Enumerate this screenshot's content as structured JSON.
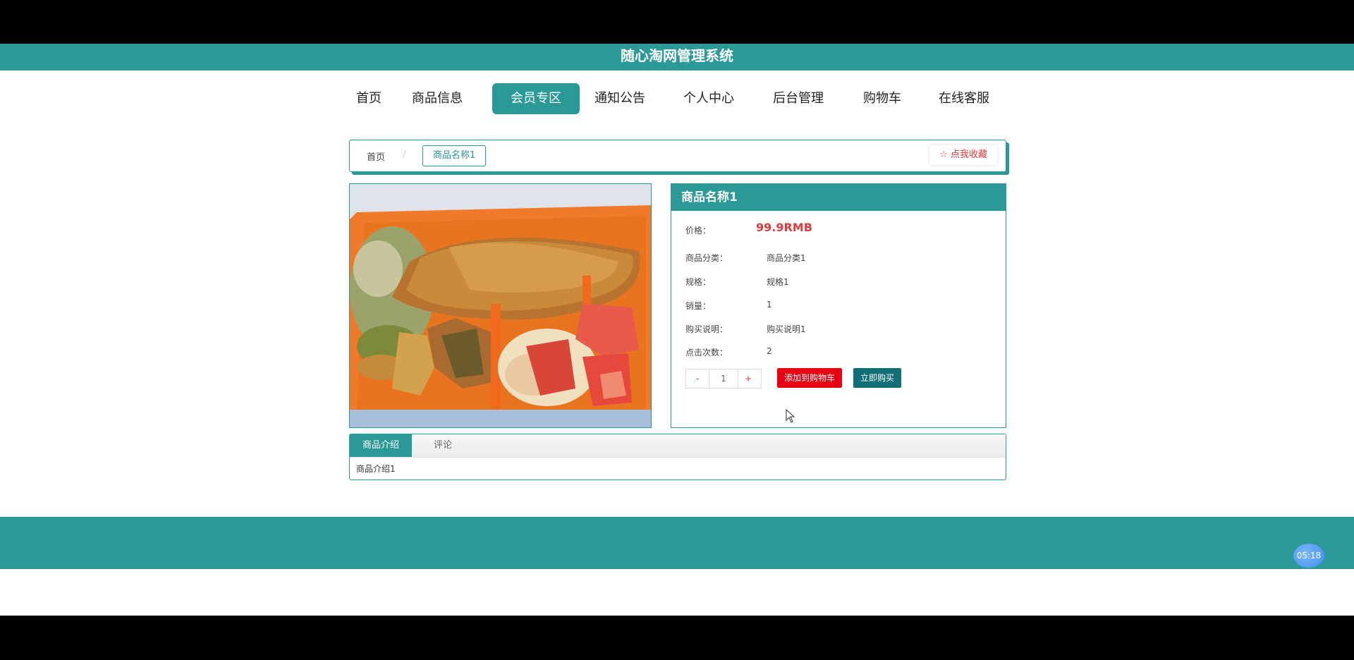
{
  "header": {
    "title": "随心淘网管理系统"
  },
  "nav": {
    "items": [
      {
        "label": "首页"
      },
      {
        "label": "商品信息"
      },
      {
        "label": "会员专区"
      },
      {
        "label": "通知公告"
      },
      {
        "label": "个人中心"
      },
      {
        "label": "后台管理"
      },
      {
        "label": "购物车"
      },
      {
        "label": "在线客服"
      }
    ],
    "active": "会员专区"
  },
  "breadcrumb": {
    "home": "首页",
    "separator": "/",
    "current": "商品名称1",
    "favorite": "☆ 点我收藏"
  },
  "product": {
    "name": "商品名称1",
    "price_label": "价格：",
    "price": "99.9RMB",
    "rows": [
      {
        "label": "商品分类：",
        "value": "商品分类1"
      },
      {
        "label": "规格：",
        "value": "规格1"
      },
      {
        "label": "销量：",
        "value": "1"
      },
      {
        "label": "购买说明：",
        "value": "购买说明1"
      },
      {
        "label": "点击次数：",
        "value": "2"
      }
    ],
    "quantity": {
      "minus": "-",
      "value": "1",
      "plus": "+"
    },
    "add_to_cart": "添加到购物车",
    "buy_now": "立即购买"
  },
  "tabs": {
    "items": [
      {
        "label": "商品介绍"
      },
      {
        "label": "评论"
      }
    ],
    "content": "商品介绍1"
  },
  "clock": {
    "time": "05:18"
  },
  "colors": {
    "accent": "#2a9997",
    "danger": "#e60012",
    "dark_teal": "#0f6f74"
  }
}
